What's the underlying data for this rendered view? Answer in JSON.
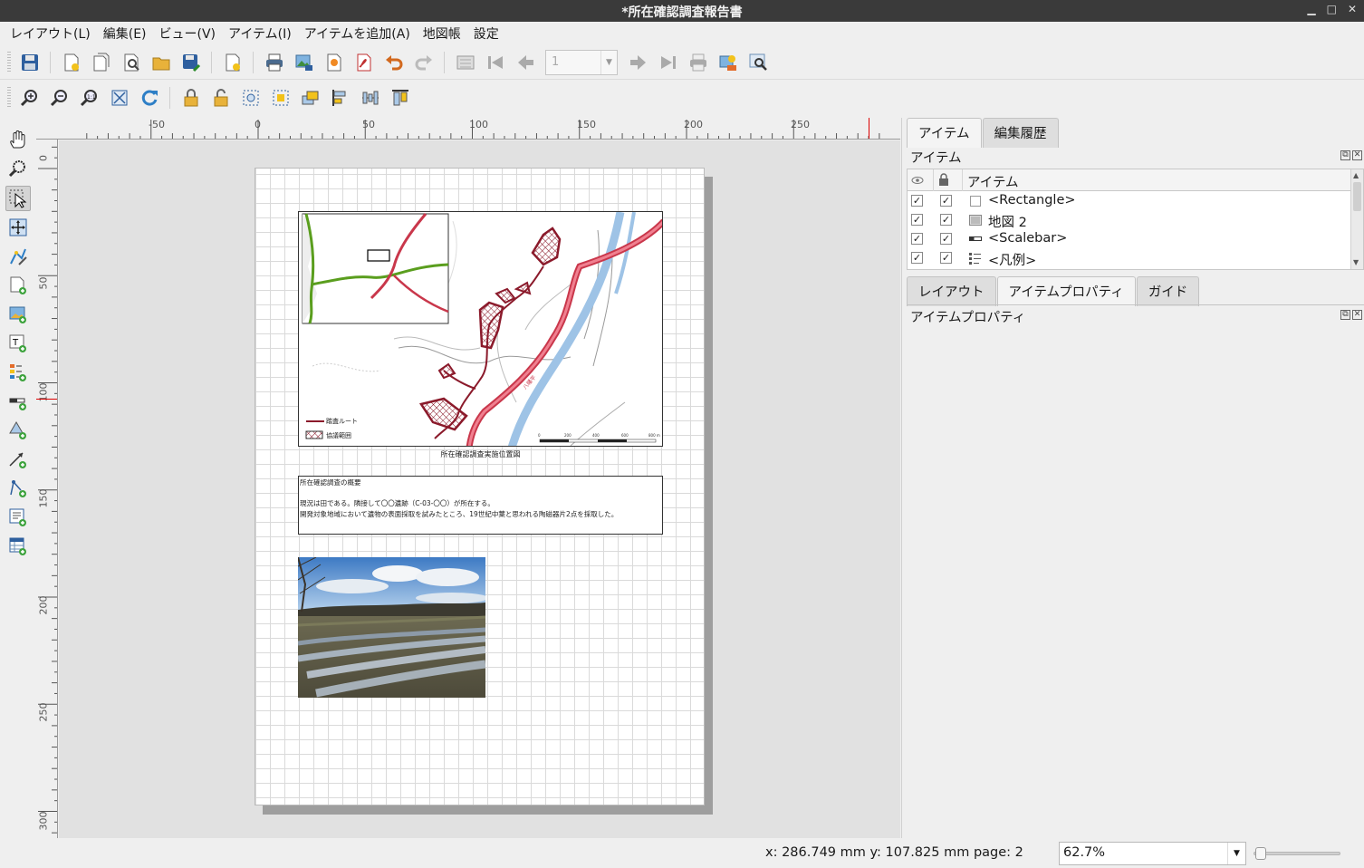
{
  "window": {
    "title": "*所在確認調査報告書"
  },
  "menu": [
    "レイアウト(L)",
    "編集(E)",
    "ビュー(V)",
    "アイテム(I)",
    "アイテムを追加(A)",
    "地図帳",
    "設定"
  ],
  "toolbar": {
    "page_number": "1"
  },
  "rulers": {
    "h_labels": [
      "-50",
      "0",
      "50",
      "100",
      "150",
      "200",
      "250"
    ],
    "v_labels": [
      "0",
      "50",
      "100",
      "150",
      "200",
      "250",
      "300"
    ]
  },
  "layout": {
    "map_legend": {
      "route": "踏査ルート",
      "area": "協議範囲"
    },
    "map_road_label": "八幡平",
    "map_caption": "所在確認調査実施位置図",
    "info": {
      "title": "所在確認調査の概要",
      "line1": "現況は田である。隣接して〇〇遺跡（C-03-〇〇）が所在する。",
      "line2": "開発対象地域において遺物の表面採取を試みたところ、19世紀中葉と思われる陶磁器片2点を採取した。"
    },
    "scalebar_labels": [
      "0",
      "200",
      "400",
      "600",
      "800 m"
    ]
  },
  "dock": {
    "top_tabs": [
      "アイテム",
      "編集履歴"
    ],
    "items_panel_title": "アイテム",
    "items_header": "アイテム",
    "items": [
      {
        "name": "<Rectangle>",
        "visible": true,
        "locked": true,
        "icon": "rectangle-icon"
      },
      {
        "name": "地図 2",
        "visible": true,
        "locked": true,
        "icon": "map-icon"
      },
      {
        "name": "<Scalebar>",
        "visible": true,
        "locked": true,
        "icon": "scalebar-icon"
      },
      {
        "name": "<凡例>",
        "visible": true,
        "locked": true,
        "icon": "legend-icon"
      }
    ],
    "bottom_tabs": [
      "レイアウト",
      "アイテムプロパティ",
      "ガイド"
    ],
    "props_panel_title": "アイテムプロパティ"
  },
  "status": {
    "coords": "x: 286.749 mm  y: 107.825 mm  page: 2",
    "zoom": "62.7%"
  },
  "colors": {
    "route": "#8b1a2b",
    "road": "#d9475a",
    "river": "#9ec3e6",
    "green_road": "#5a9e1e"
  }
}
